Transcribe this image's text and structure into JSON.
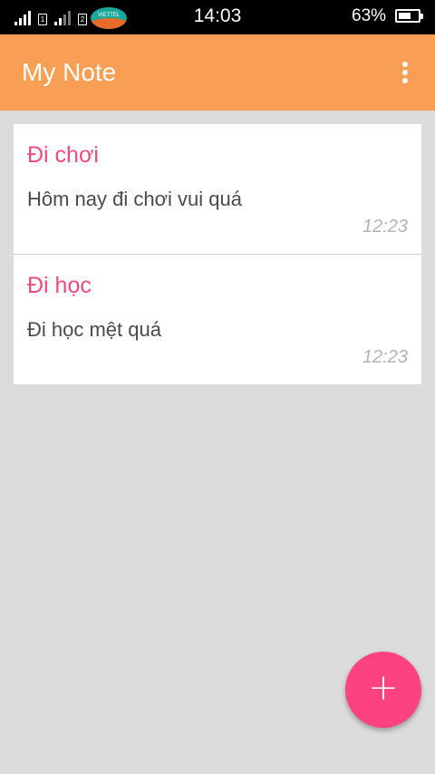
{
  "status_bar": {
    "time": "14:03",
    "battery_percent": "63%",
    "battery_level": 0.63,
    "sim1_label": "1",
    "sim2_label": "2",
    "carrier_logo": "VIETTEL"
  },
  "app_bar": {
    "title": "My Note",
    "overflow_icon": "more-vert-icon"
  },
  "notes": [
    {
      "title": "Đi chơi",
      "body": "Hôm nay đi chơi vui quá",
      "time": "12:23"
    },
    {
      "title": "Đi học",
      "body": "Đi học mệt quá",
      "time": "12:23"
    }
  ],
  "fab": {
    "icon": "plus-icon",
    "label": "+"
  },
  "colors": {
    "app_bar": "#f89f55",
    "note_title": "#f0497d",
    "fab": "#fc4281",
    "background": "#dcdcdc"
  }
}
